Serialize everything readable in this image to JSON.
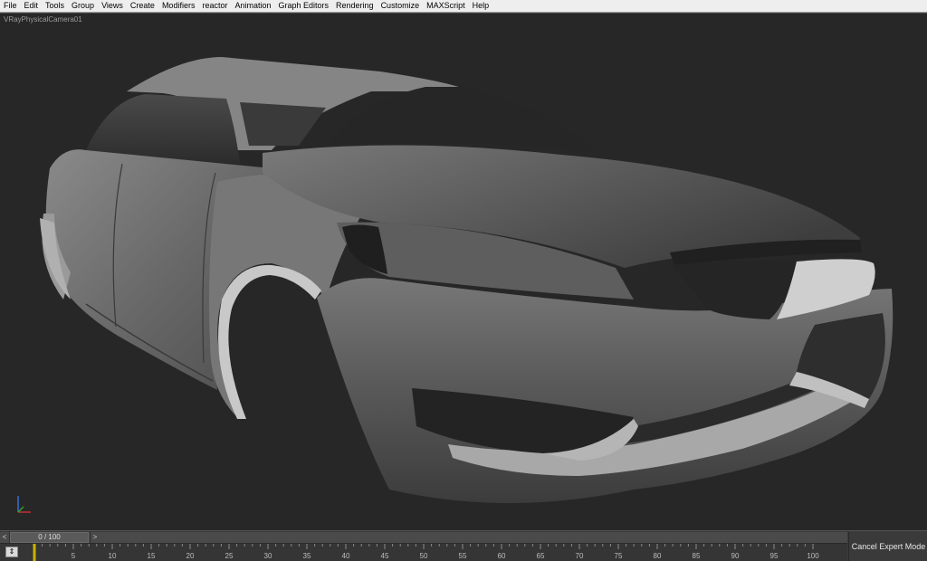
{
  "menubar": {
    "items": [
      "File",
      "Edit",
      "Tools",
      "Group",
      "Views",
      "Create",
      "Modifiers",
      "reactor",
      "Animation",
      "Graph Editors",
      "Rendering",
      "Customize",
      "MAXScript",
      "Help"
    ]
  },
  "viewport": {
    "label": "VRayPhysicalCamera01"
  },
  "timeline": {
    "slider_text": "0 / 100",
    "prev_glyph": "<",
    "next_glyph": ">",
    "key_mode_glyph": "⇕",
    "ruler_max": 100,
    "ruler_label_step": 5,
    "ruler_labels": [
      "5",
      "10",
      "15",
      "20",
      "25",
      "30",
      "35",
      "40",
      "45",
      "50",
      "55",
      "60",
      "65",
      "70",
      "75",
      "80",
      "85",
      "90",
      "95",
      "100"
    ],
    "current_frame": 0
  },
  "status": {
    "cancel_expert_label": "Cancel Expert Mode"
  },
  "colors": {
    "menubar_bg": "#eeeeee",
    "viewport_bg": "#272727",
    "timeline_bg": "#3a3a3a",
    "frame_marker": "#c8b400"
  }
}
